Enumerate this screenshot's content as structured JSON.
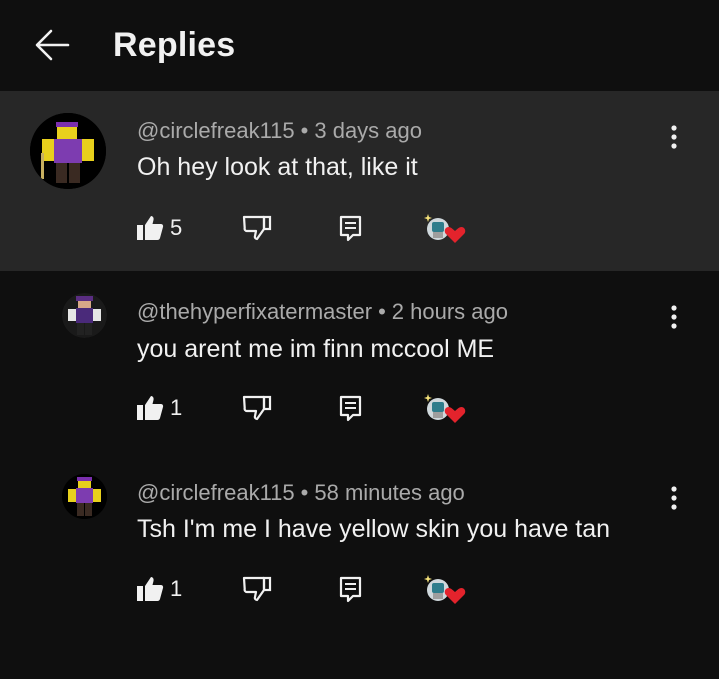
{
  "header": {
    "title": "Replies"
  },
  "colors": {
    "background": "#0f0f0f",
    "highlight_background": "#272727",
    "meta_text": "#aaaaaa",
    "text": "#f1f1f1",
    "heart": "#e3232c"
  },
  "comments": [
    {
      "handle": "@circlefreak115",
      "time": "3 days ago",
      "text": "Oh hey look at that, like it",
      "likes": "5",
      "highlighted": true,
      "creator_heart": true
    },
    {
      "handle": "@thehyperfixatermaster",
      "time": "2 hours ago",
      "text": "you arent me im finn mccool ME",
      "likes": "1",
      "highlighted": false,
      "creator_heart": true
    },
    {
      "handle": "@circlefreak115",
      "time": "58 minutes ago",
      "text": "Tsh I'm me I have yellow skin you have tan",
      "likes": "1",
      "highlighted": false,
      "creator_heart": true
    }
  ],
  "separator": "•",
  "icons": {
    "back": "arrow-left-icon",
    "like": "thumbs-up-icon",
    "dislike": "thumbs-down-icon",
    "reply": "reply-icon",
    "heart": "creator-heart-icon",
    "more": "more-vert-icon"
  }
}
